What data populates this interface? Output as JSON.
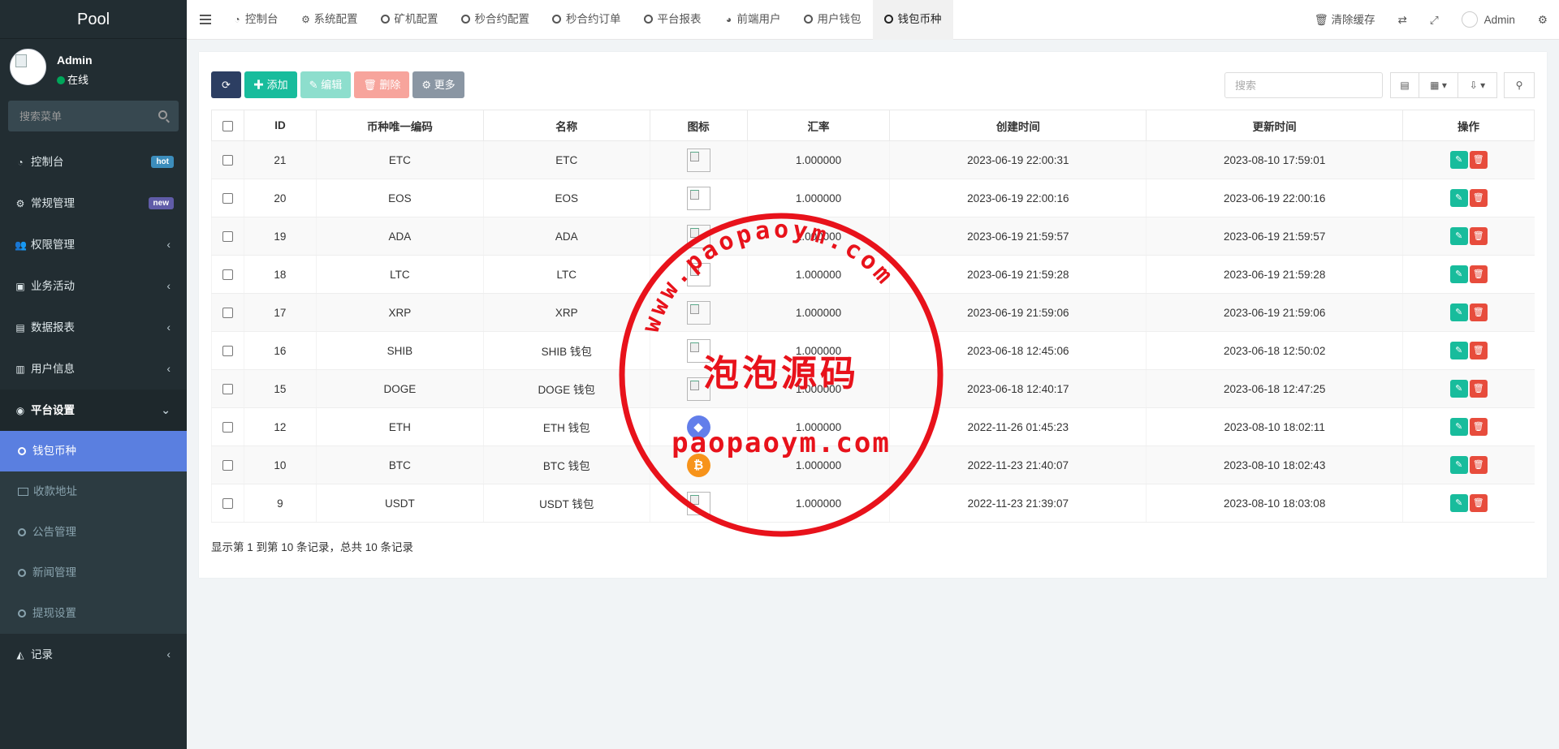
{
  "sidebar": {
    "logo": "Pool",
    "user": {
      "name": "Admin",
      "status": "在线"
    },
    "search_placeholder": "搜索菜单",
    "menu": [
      {
        "label": "控制台",
        "icon": "dashboard-icon",
        "badge": "hot"
      },
      {
        "label": "常规管理",
        "icon": "cogs-icon",
        "badge": "new"
      },
      {
        "label": "权限管理",
        "icon": "users-icon",
        "arrow": "‹"
      },
      {
        "label": "业务活动",
        "icon": "money-icon",
        "arrow": "‹"
      },
      {
        "label": "数据报表",
        "icon": "file-icon",
        "arrow": "‹"
      },
      {
        "label": "用户信息",
        "icon": "address-book-icon",
        "arrow": "‹"
      },
      {
        "label": "平台设置",
        "icon": "circle-dot-icon",
        "arrow": "⌄"
      }
    ],
    "submenu": [
      {
        "label": "钱包币种",
        "active": true
      },
      {
        "label": "收款地址"
      },
      {
        "label": "公告管理"
      },
      {
        "label": "新闻管理"
      },
      {
        "label": "提现设置"
      }
    ],
    "records": {
      "label": "记录",
      "icon": "area-chart-icon"
    }
  },
  "topbar": {
    "tabs": [
      {
        "label": "控制台",
        "icon": "dashboard-icon"
      },
      {
        "label": "系统配置",
        "icon": "gear-icon"
      },
      {
        "label": "矿机配置"
      },
      {
        "label": "秒合约配置"
      },
      {
        "label": "秒合约订单"
      },
      {
        "label": "平台报表"
      },
      {
        "label": "前端用户",
        "icon": "user-circle-icon"
      },
      {
        "label": "用户钱包"
      },
      {
        "label": "钱包币种",
        "active": true
      }
    ],
    "clear_cache": "清除缓存",
    "admin": "Admin"
  },
  "toolbar": {
    "add": "添加",
    "edit": "编辑",
    "delete": "删除",
    "more": "更多",
    "search_placeholder": "搜索"
  },
  "table": {
    "columns": [
      "ID",
      "币种唯一编码",
      "名称",
      "图标",
      "汇率",
      "创建时间",
      "更新时间",
      "操作"
    ],
    "rows": [
      {
        "id": "21",
        "code": "ETC",
        "name": "ETC",
        "icon": "broken-image",
        "rate": "1.000000",
        "created": "2023-06-19 22:00:31",
        "updated": "2023-08-10 17:59:01"
      },
      {
        "id": "20",
        "code": "EOS",
        "name": "EOS",
        "icon": "broken-image",
        "rate": "1.000000",
        "created": "2023-06-19 22:00:16",
        "updated": "2023-06-19 22:00:16"
      },
      {
        "id": "19",
        "code": "ADA",
        "name": "ADA",
        "icon": "broken-image",
        "rate": "1.000000",
        "created": "2023-06-19 21:59:57",
        "updated": "2023-06-19 21:59:57"
      },
      {
        "id": "18",
        "code": "LTC",
        "name": "LTC",
        "icon": "broken-image",
        "rate": "1.000000",
        "created": "2023-06-19 21:59:28",
        "updated": "2023-06-19 21:59:28"
      },
      {
        "id": "17",
        "code": "XRP",
        "name": "XRP",
        "icon": "broken-image",
        "rate": "1.000000",
        "created": "2023-06-19 21:59:06",
        "updated": "2023-06-19 21:59:06"
      },
      {
        "id": "16",
        "code": "SHIB",
        "name": "SHIB 钱包",
        "icon": "broken-image",
        "rate": "1.000000",
        "created": "2023-06-18 12:45:06",
        "updated": "2023-06-18 12:50:02"
      },
      {
        "id": "15",
        "code": "DOGE",
        "name": "DOGE 钱包",
        "icon": "broken-image",
        "rate": "1.000000",
        "created": "2023-06-18 12:40:17",
        "updated": "2023-06-18 12:47:25"
      },
      {
        "id": "12",
        "code": "ETH",
        "name": "ETH 钱包",
        "icon": "eth",
        "rate": "1.000000",
        "created": "2022-11-26 01:45:23",
        "updated": "2023-08-10 18:02:11"
      },
      {
        "id": "10",
        "code": "BTC",
        "name": "BTC 钱包",
        "icon": "btc",
        "rate": "1.000000",
        "created": "2022-11-23 21:40:07",
        "updated": "2023-08-10 18:02:43"
      },
      {
        "id": "9",
        "code": "USDT",
        "name": "USDT 钱包",
        "icon": "broken-image",
        "rate": "1.000000",
        "created": "2022-11-23 21:39:07",
        "updated": "2023-08-10 18:03:08"
      }
    ]
  },
  "pagination_info": "显示第 1 到第 10 条记录，总共 10 条记录",
  "watermark": {
    "arc_text": "www.paopaoym.com",
    "center_text": "泡泡源码",
    "bottom_text": "paopaoym.com",
    "color": "#e8121b"
  }
}
